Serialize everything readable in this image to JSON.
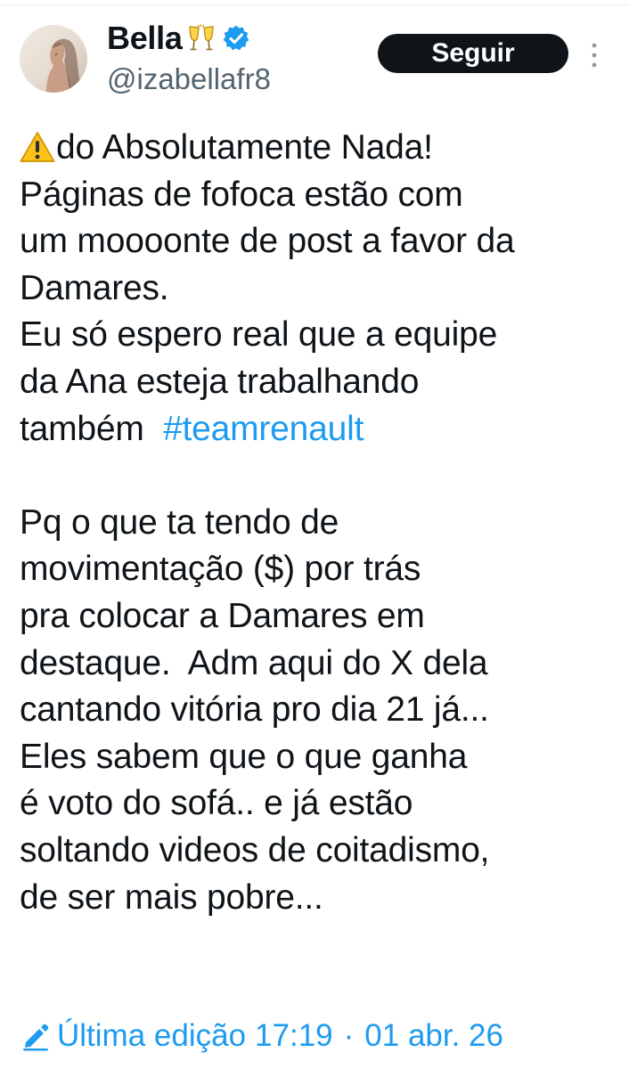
{
  "author": {
    "display_name": "Bella",
    "name_emoji": "clinking-glasses-icon",
    "verified_icon": "verified-badge-icon",
    "handle": "@izabellafr8",
    "avatar_icon": "profile-photo"
  },
  "actions": {
    "follow_label": "Seguir",
    "more_icon": "more-options-icon"
  },
  "tweet": {
    "leading_icon": "warning-icon",
    "line1": "do Absolutamente Nada!",
    "line2": "Páginas de fofoca estão com",
    "line3": "um moooonte de post a favor da",
    "line4": "Damares.",
    "line5": "Eu só espero real que a equipe",
    "line6": "da Ana esteja trabalhando",
    "line7": "também ",
    "hashtag": "#teamrenault",
    "line8": "Pq o que ta tendo de",
    "line9": "movimentação ($) por trás",
    "line10": "pra colocar a Damares em",
    "line11": "destaque.  Adm aqui do X dela",
    "line12": "cantando vitória pro dia 21 já...",
    "line13": "Eles sabem que o que ganha",
    "line14": "é voto do sofá.. e já estão",
    "line15": "soltando videos de coitadismo,",
    "line16": "de ser mais pobre..."
  },
  "edit_info": {
    "icon": "pencil-icon",
    "label": "Última edição",
    "time": "17:19",
    "separator": "·",
    "date": "01 abr. 26"
  },
  "colors": {
    "text": "#0f1419",
    "secondary": "#536471",
    "link": "#1d9bf0",
    "button_bg": "#0f1419",
    "button_text": "#ffffff"
  }
}
